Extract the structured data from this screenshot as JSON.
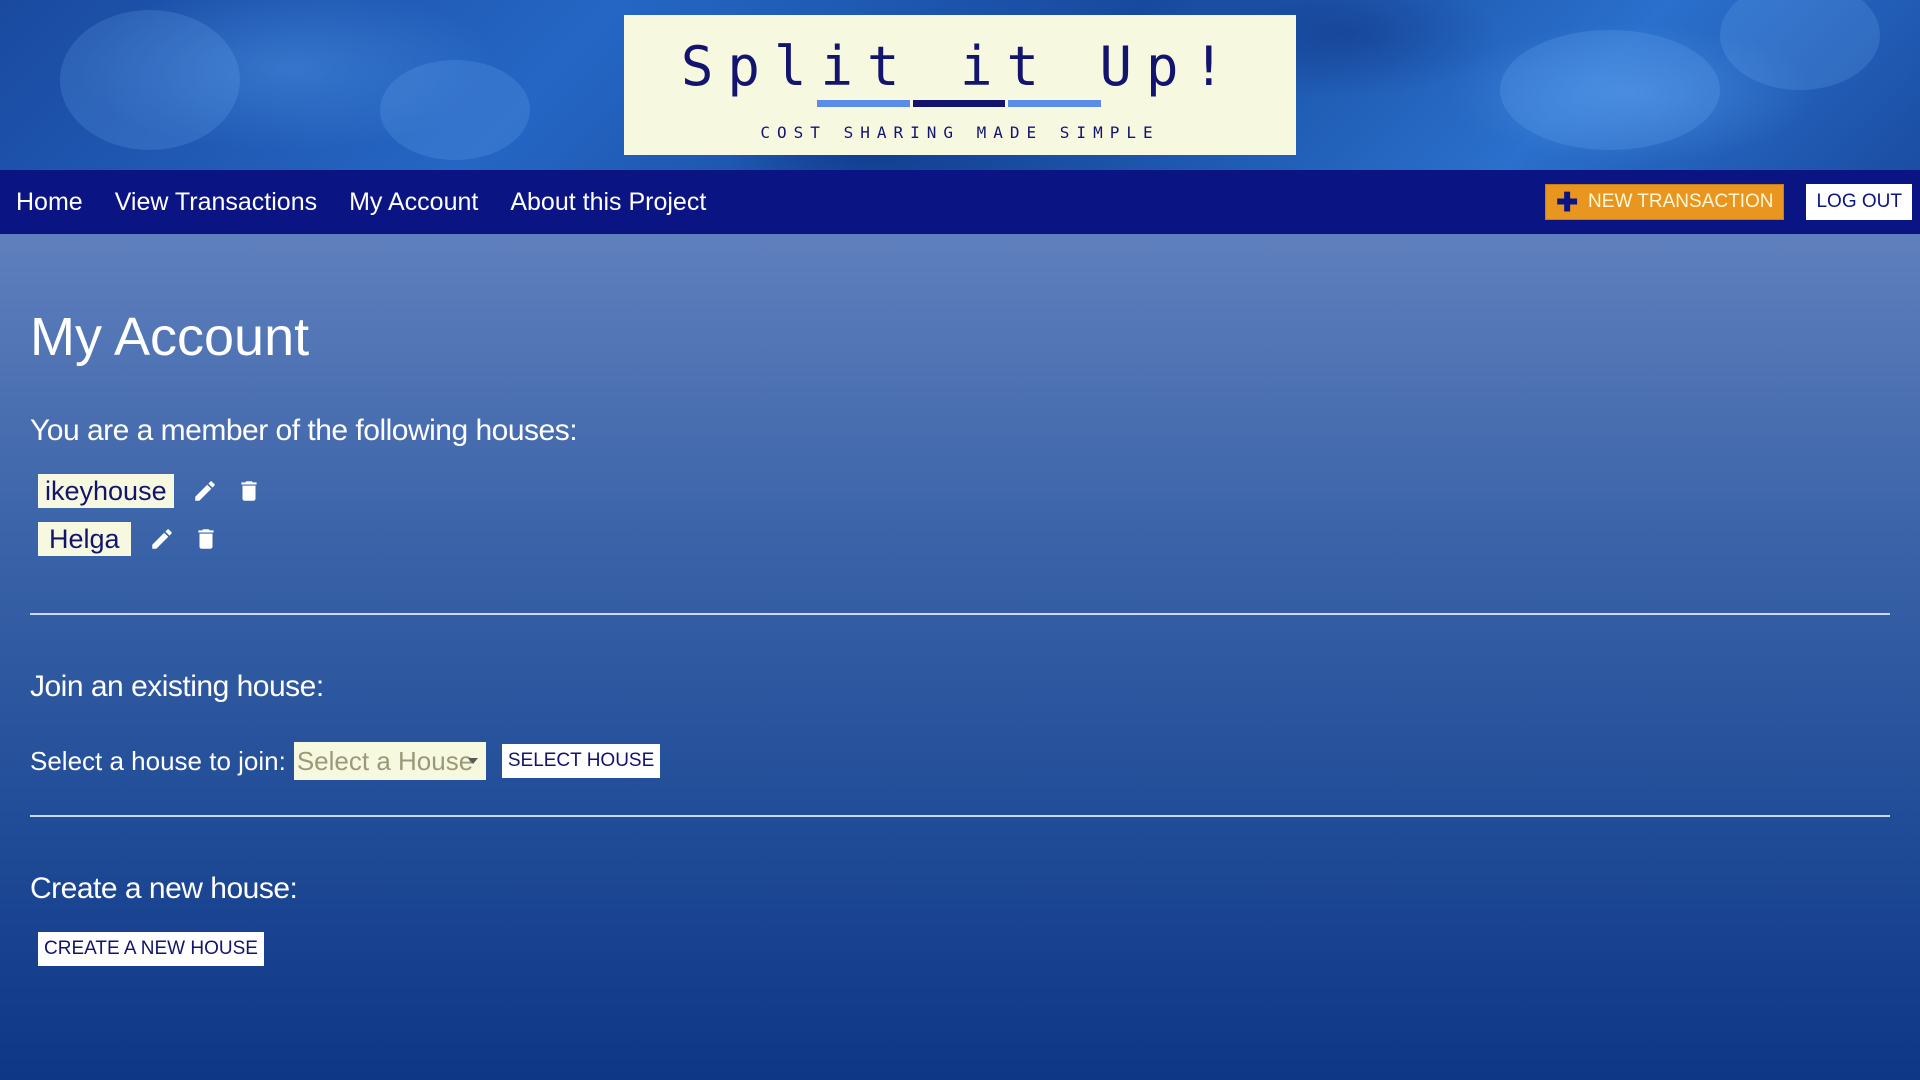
{
  "header": {
    "logo_title": "Split it Up!",
    "logo_subtitle": "COST SHARING MADE SIMPLE",
    "logo_bar_colors": [
      "#5b8ce8",
      "#12146e",
      "#5b8ce8"
    ]
  },
  "nav": {
    "links": [
      {
        "label": "Home"
      },
      {
        "label": "View Transactions"
      },
      {
        "label": "My Account"
      },
      {
        "label": "About this Project"
      }
    ],
    "new_transaction_label": "NEW TRANSACTION",
    "logout_label": "LOG OUT",
    "new_transaction_icon": "plus-icon"
  },
  "main": {
    "title": "My Account",
    "houses_heading": "You are a member of the following houses:",
    "houses": [
      {
        "name": "ikeyhouse"
      },
      {
        "name": "Helga"
      }
    ],
    "house_icons": [
      "edit-pencil-icon",
      "trash-icon"
    ],
    "join_heading": "Join an existing house:",
    "join_label": "Select a house to join:",
    "select_placeholder": "Select a House",
    "select_button_label": "SELECT HOUSE",
    "create_heading": "Create a new house:",
    "create_button_label": "CREATE A NEW HOUSE"
  },
  "colors": {
    "nav_bg": "#0b1483",
    "accent_orange": "#e89620",
    "card_cream": "#f7f8e0",
    "text_navy": "#12146e"
  }
}
